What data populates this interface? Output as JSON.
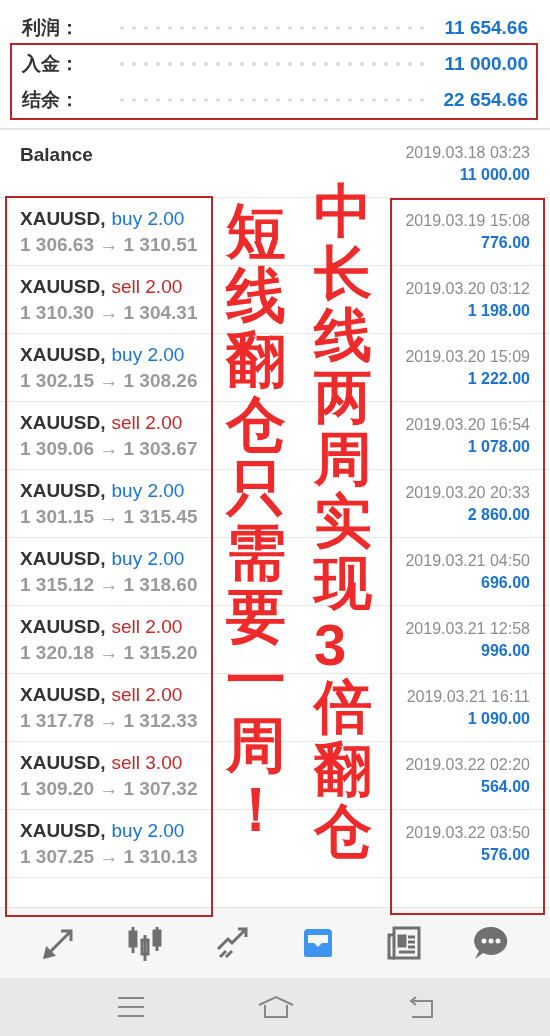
{
  "summary": [
    {
      "label": "利润：",
      "value": "11 654.66"
    },
    {
      "label": "入金：",
      "value": "11 000.00"
    },
    {
      "label": "结余：",
      "value": "22 654.66"
    }
  ],
  "balance": {
    "title": "Balance",
    "time": "2019.03.18 03:23",
    "amount": "11 000.00"
  },
  "trades": [
    {
      "symbol": "XAUUSD,",
      "side": "buy",
      "lots": "2.00",
      "prices": "1 306.63 → 1 310.51",
      "time": "2019.03.19 15:08",
      "profit": "776.00"
    },
    {
      "symbol": "XAUUSD,",
      "side": "sell",
      "lots": "2.00",
      "prices": "1 310.30 → 1 304.31",
      "time": "2019.03.20 03:12",
      "profit": "1 198.00"
    },
    {
      "symbol": "XAUUSD,",
      "side": "buy",
      "lots": "2.00",
      "prices": "1 302.15 → 1 308.26",
      "time": "2019.03.20 15:09",
      "profit": "1 222.00"
    },
    {
      "symbol": "XAUUSD,",
      "side": "sell",
      "lots": "2.00",
      "prices": "1 309.06 → 1 303.67",
      "time": "2019.03.20 16:54",
      "profit": "1 078.00"
    },
    {
      "symbol": "XAUUSD,",
      "side": "buy",
      "lots": "2.00",
      "prices": "1 301.15 → 1 315.45",
      "time": "2019.03.20 20:33",
      "profit": "2 860.00"
    },
    {
      "symbol": "XAUUSD,",
      "side": "buy",
      "lots": "2.00",
      "prices": "1 315.12 → 1 318.60",
      "time": "2019.03.21 04:50",
      "profit": "696.00"
    },
    {
      "symbol": "XAUUSD,",
      "side": "sell",
      "lots": "2.00",
      "prices": "1 320.18 → 1 315.20",
      "time": "2019.03.21 12:58",
      "profit": "996.00"
    },
    {
      "symbol": "XAUUSD,",
      "side": "sell",
      "lots": "2.00",
      "prices": "1 317.78 → 1 312.33",
      "time": "2019.03.21 16:11",
      "profit": "1 090.00"
    },
    {
      "symbol": "XAUUSD,",
      "side": "sell",
      "lots": "3.00",
      "prices": "1 309.20 → 1 307.32",
      "time": "2019.03.22 02:20",
      "profit": "564.00"
    },
    {
      "symbol": "XAUUSD,",
      "side": "buy",
      "lots": "2.00",
      "prices": "1 307.25 → 1 310.13",
      "time": "2019.03.22 03:50",
      "profit": "576.00"
    }
  ],
  "annotations": [
    "短线翻仓只需要一周！",
    "中长线两周实现3倍翻仓"
  ],
  "nav": [
    {
      "kind": "trade",
      "selected": false
    },
    {
      "kind": "candles",
      "selected": false
    },
    {
      "kind": "chart",
      "selected": false
    },
    {
      "kind": "history",
      "selected": true
    },
    {
      "kind": "news",
      "selected": false
    },
    {
      "kind": "chat",
      "selected": false
    }
  ]
}
